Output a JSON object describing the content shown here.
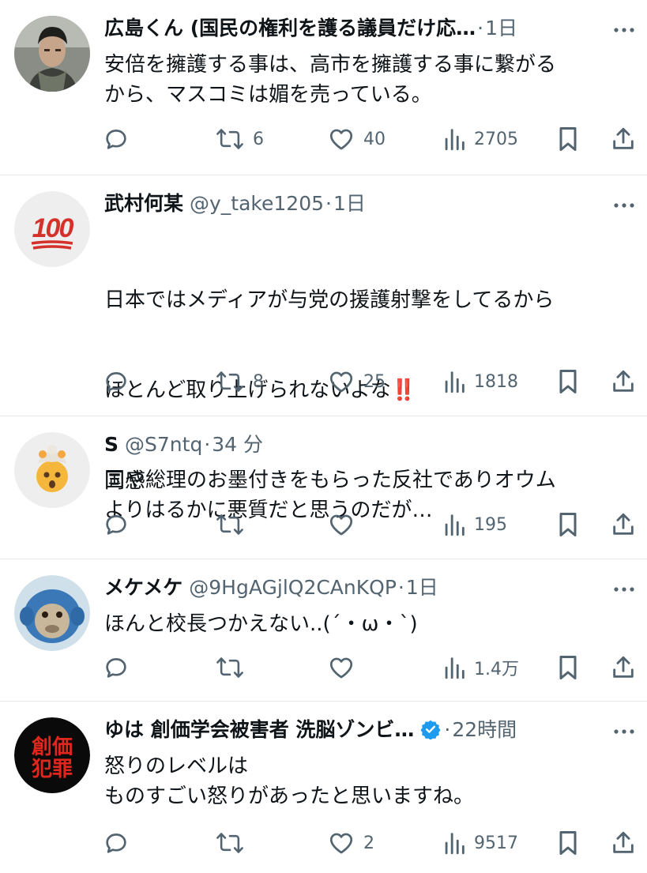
{
  "tweets": [
    {
      "name": "広島くん (国民の権利を護る議員だけ応…",
      "handle": "",
      "time": "1日",
      "body": "安倍を擁護する事は、高市を擁護する事に繋がる\nから、マスコミは媚を売っている。",
      "replies": "",
      "retweets": "6",
      "likes": "40",
      "views": "2705",
      "avatar_icon": "person-photo-avatar"
    },
    {
      "name": "武村何某",
      "handle": "@y_take1205",
      "time": "1日",
      "body_line1": "日本ではメディアが与党の援護射撃をしてるから",
      "body_line2": "ほとんど取り上げられないよな",
      "body_bang": "‼️",
      "body_rest": "国や総理のお墨付きをもらった反社でありオウム\nよりはるかに悪質だと思うのだが…",
      "replies": "",
      "retweets": "8",
      "likes": "25",
      "views": "1818",
      "avatar_text": "100"
    },
    {
      "name": "S",
      "handle": "@S7ntq",
      "time": "34 分",
      "body": "同感",
      "replies": "",
      "retweets": "",
      "likes": "",
      "views": "195",
      "avatar_icon": "exploding-head-emoji-avatar"
    },
    {
      "name": "メケメケ",
      "handle": "@9HgAGjlQ2CAnKQP",
      "time": "1日",
      "body": "ほんと校長つかえない..(´・ω・`)",
      "replies": "",
      "retweets": "",
      "likes": "",
      "views": "1.4万",
      "avatar_icon": "monkey-avatar"
    },
    {
      "name": "ゆは 創価学会被害者 洗脳ゾンビ…",
      "handle": "",
      "time": "22時間",
      "body": "怒りのレベルは\nものすごい怒りがあったと思いますね。",
      "replies": "",
      "retweets": "",
      "likes": "2",
      "views": "9517",
      "avatar_text_1": "創価",
      "avatar_text_2": "犯罪",
      "verified": true
    }
  ],
  "colors": {
    "text": "#0f1419",
    "secondary": "#536471",
    "divider": "#e6e9ec",
    "verified": "#1d9bf0",
    "hundred_red": "#d4312a"
  },
  "icons": [
    "reply-icon",
    "retweet-icon",
    "like-icon",
    "views-icon",
    "bookmark-icon",
    "share-icon",
    "more-icon",
    "verified-badge-icon"
  ]
}
